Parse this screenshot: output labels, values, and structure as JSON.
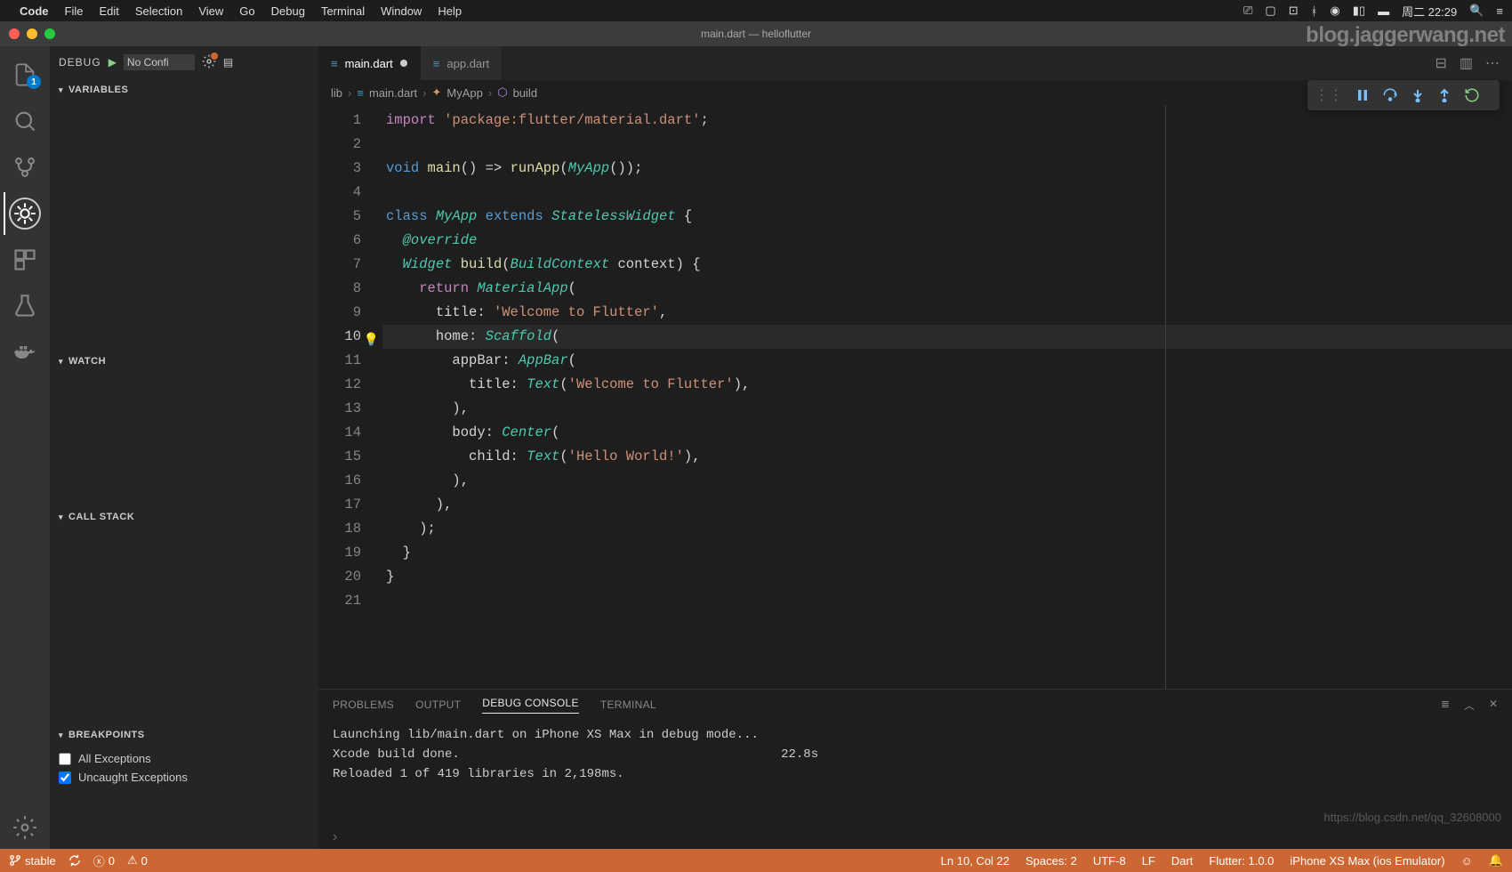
{
  "macMenu": {
    "app": "Code",
    "items": [
      "File",
      "Edit",
      "Selection",
      "View",
      "Go",
      "Debug",
      "Terminal",
      "Window",
      "Help"
    ],
    "clock": "周二 22:29"
  },
  "window": {
    "title": "main.dart — helloflutter",
    "watermark": "blog.jaggerwang.net"
  },
  "activity": {
    "explorerBadge": "1"
  },
  "debugPanel": {
    "label": "DEBUG",
    "config": "No Confi",
    "sections": {
      "variables": "VARIABLES",
      "watch": "WATCH",
      "callstack": "CALL STACK",
      "breakpoints": "BREAKPOINTS"
    },
    "bpItems": [
      "All Exceptions",
      "Uncaught Exceptions"
    ]
  },
  "tabs": [
    {
      "name": "main.dart",
      "dirty": true,
      "active": true
    },
    {
      "name": "app.dart",
      "dirty": false,
      "active": false
    }
  ],
  "breadcrumb": [
    "lib",
    "main.dart",
    "MyApp",
    "build"
  ],
  "code": {
    "lines": [
      {
        "n": 1,
        "segs": [
          [
            "kw2",
            "import"
          ],
          [
            "punct",
            " "
          ],
          [
            "str",
            "'package:flutter/material.dart'"
          ],
          [
            "punct",
            ";"
          ]
        ]
      },
      {
        "n": 2,
        "segs": []
      },
      {
        "n": 3,
        "segs": [
          [
            "kw",
            "void"
          ],
          [
            "punct",
            " "
          ],
          [
            "fn",
            "main"
          ],
          [
            "punct",
            "() "
          ],
          [
            "punct",
            "=> "
          ],
          [
            "fn",
            "runApp"
          ],
          [
            "punct",
            "("
          ],
          [
            "cls",
            "MyApp"
          ],
          [
            "punct",
            "());"
          ]
        ]
      },
      {
        "n": 4,
        "segs": []
      },
      {
        "n": 5,
        "segs": [
          [
            "kw",
            "class"
          ],
          [
            "punct",
            " "
          ],
          [
            "cls",
            "MyApp"
          ],
          [
            "punct",
            " "
          ],
          [
            "kw",
            "extends"
          ],
          [
            "punct",
            " "
          ],
          [
            "cls",
            "StatelessWidget"
          ],
          [
            "punct",
            " {"
          ]
        ]
      },
      {
        "n": 6,
        "segs": [
          [
            "punct",
            "  "
          ],
          [
            "ann",
            "@override"
          ]
        ]
      },
      {
        "n": 7,
        "segs": [
          [
            "punct",
            "  "
          ],
          [
            "cls",
            "Widget"
          ],
          [
            "punct",
            " "
          ],
          [
            "fn",
            "build"
          ],
          [
            "punct",
            "("
          ],
          [
            "cls",
            "BuildContext"
          ],
          [
            "punct",
            " context) {"
          ]
        ]
      },
      {
        "n": 8,
        "segs": [
          [
            "punct",
            "    "
          ],
          [
            "kw2",
            "return"
          ],
          [
            "punct",
            " "
          ],
          [
            "cls",
            "MaterialApp"
          ],
          [
            "punct",
            "("
          ]
        ]
      },
      {
        "n": 9,
        "segs": [
          [
            "punct",
            "      "
          ],
          [
            "ident",
            "title"
          ],
          [
            "punct",
            ": "
          ],
          [
            "str",
            "'Welcome to Flutter'"
          ],
          [
            "punct",
            ","
          ]
        ]
      },
      {
        "n": 10,
        "segs": [
          [
            "punct",
            "      "
          ],
          [
            "ident",
            "home"
          ],
          [
            "punct",
            ": "
          ],
          [
            "cls",
            "Scaffold"
          ],
          [
            "punct",
            "("
          ]
        ],
        "current": true,
        "bulb": true
      },
      {
        "n": 11,
        "segs": [
          [
            "punct",
            "        "
          ],
          [
            "ident",
            "appBar"
          ],
          [
            "punct",
            ": "
          ],
          [
            "cls",
            "AppBar"
          ],
          [
            "punct",
            "("
          ]
        ]
      },
      {
        "n": 12,
        "segs": [
          [
            "punct",
            "          "
          ],
          [
            "ident",
            "title"
          ],
          [
            "punct",
            ": "
          ],
          [
            "cls",
            "Text"
          ],
          [
            "punct",
            "("
          ],
          [
            "str",
            "'Welcome to Flutter'"
          ],
          [
            "punct",
            "),"
          ]
        ]
      },
      {
        "n": 13,
        "segs": [
          [
            "punct",
            "        ),"
          ]
        ]
      },
      {
        "n": 14,
        "segs": [
          [
            "punct",
            "        "
          ],
          [
            "ident",
            "body"
          ],
          [
            "punct",
            ": "
          ],
          [
            "cls",
            "Center"
          ],
          [
            "punct",
            "("
          ]
        ]
      },
      {
        "n": 15,
        "segs": [
          [
            "punct",
            "          "
          ],
          [
            "ident",
            "child"
          ],
          [
            "punct",
            ": "
          ],
          [
            "cls",
            "Text"
          ],
          [
            "punct",
            "("
          ],
          [
            "str",
            "'Hello World!'"
          ],
          [
            "punct",
            "),"
          ]
        ]
      },
      {
        "n": 16,
        "segs": [
          [
            "punct",
            "        ),"
          ]
        ]
      },
      {
        "n": 17,
        "segs": [
          [
            "punct",
            "      ),"
          ]
        ]
      },
      {
        "n": 18,
        "segs": [
          [
            "punct",
            "    );"
          ]
        ]
      },
      {
        "n": 19,
        "segs": [
          [
            "punct",
            "  }"
          ]
        ]
      },
      {
        "n": 20,
        "segs": [
          [
            "punct",
            "}"
          ]
        ]
      },
      {
        "n": 21,
        "segs": []
      }
    ]
  },
  "bottomPanel": {
    "tabs": [
      "PROBLEMS",
      "OUTPUT",
      "DEBUG CONSOLE",
      "TERMINAL"
    ],
    "activeTab": 2,
    "console": "Launching lib/main.dart on iPhone XS Max in debug mode...\nXcode build done.                                           22.8s\nReloaded 1 of 419 libraries in 2,198ms."
  },
  "statusBar": {
    "branch": "stable",
    "errors": "0",
    "warnings": "0",
    "cursor": "Ln 10, Col 22",
    "spaces": "Spaces: 2",
    "encoding": "UTF-8",
    "eol": "LF",
    "lang": "Dart",
    "flutter": "Flutter: 1.0.0",
    "device": "iPhone XS Max (ios Emulator)"
  },
  "csdn": "https://blog.csdn.net/qq_32608000"
}
